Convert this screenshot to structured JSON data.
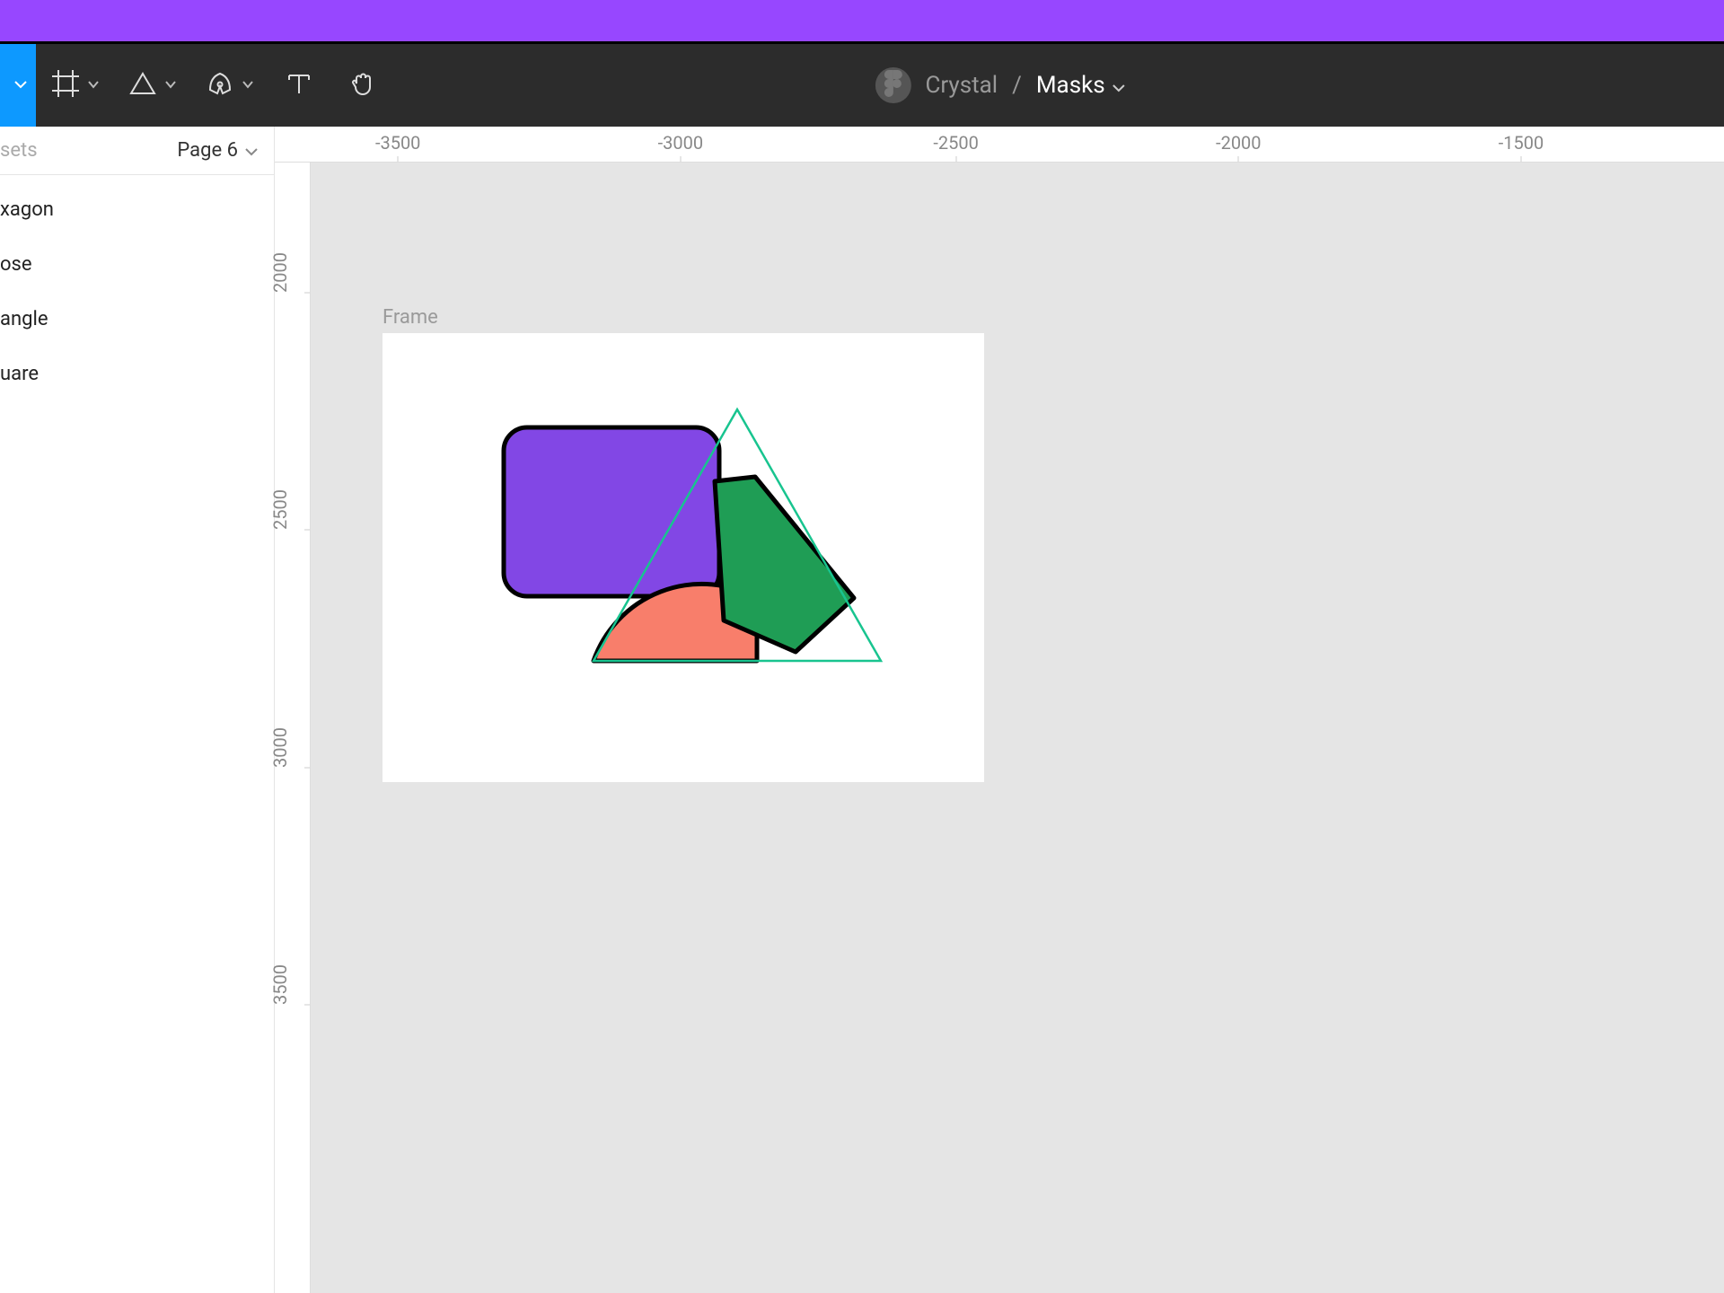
{
  "header": {
    "team_name": "Crystal",
    "file_name": "Masks"
  },
  "sidebar": {
    "tab_label": "sets",
    "page_label": "Page 6",
    "layers": [
      "xagon",
      "ose",
      "angle",
      "uare"
    ]
  },
  "ruler": {
    "top_ticks": [
      {
        "label": "-3500",
        "x_pct": 8.5
      },
      {
        "label": "-3000",
        "x_pct": 28
      },
      {
        "label": "-2500",
        "x_pct": 47
      },
      {
        "label": "-2000",
        "x_pct": 66.5
      },
      {
        "label": "-1500",
        "x_pct": 86
      }
    ],
    "left_ticks": [
      {
        "label": "2000",
        "y_pct": 11.5
      },
      {
        "label": "2500",
        "y_pct": 32.5
      },
      {
        "label": "3000",
        "y_pct": 53.5
      },
      {
        "label": "3500",
        "y_pct": 74.5
      }
    ]
  },
  "frame": {
    "label": "Frame"
  },
  "colors": {
    "accent_purple": "#9747FF",
    "toolbar_bg": "#2c2c2c",
    "canvas_bg": "#e5e5e5",
    "shape_purple": "#8247E5",
    "shape_green": "#1F9D55",
    "shape_coral": "#F87E6B",
    "selection_teal": "#18C48F"
  }
}
